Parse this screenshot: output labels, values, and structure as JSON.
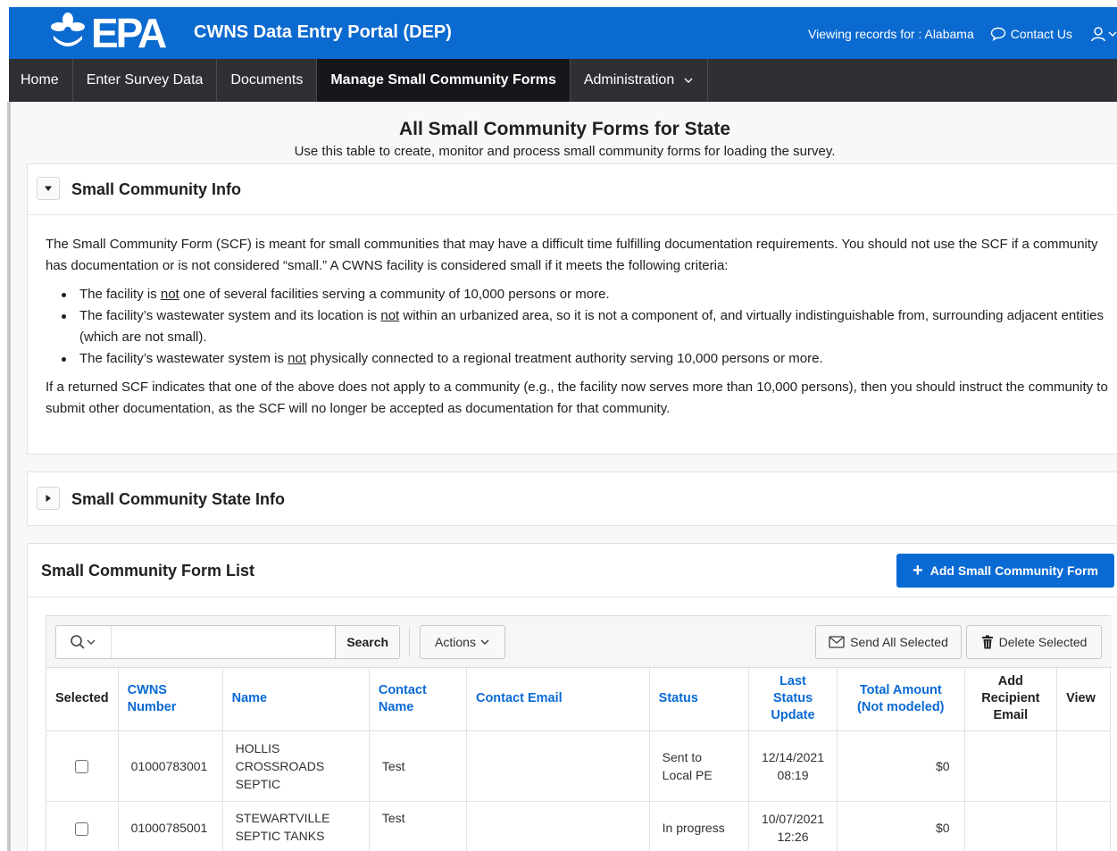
{
  "header": {
    "logo_text": "EPA",
    "app_title": "CWNS Data Entry Portal (DEP)",
    "viewing_records": "Viewing records for : Alabama",
    "contact_us": "Contact Us",
    "user_icon": "user-icon",
    "colors": {
      "brand": "#0b6ad0",
      "nav": "#2f3033",
      "nav_active": "#16171a",
      "primary_button": "#0a6ad4"
    }
  },
  "nav": {
    "items": [
      {
        "label": "Home"
      },
      {
        "label": "Enter Survey Data"
      },
      {
        "label": "Documents"
      },
      {
        "label": "Manage Small Community Forms"
      },
      {
        "label": "Administration"
      }
    ],
    "active": "Manage Small Community Forms"
  },
  "page": {
    "title": "All Small Community Forms for State",
    "subtitle": "Use this table to create, monitor and process small community forms for loading the survey."
  },
  "info_region": {
    "title": "Small Community Info",
    "expanded": true,
    "p1": "The Small Community Form (SCF) is meant for small communities that may have a difficult time fulfilling documentation requirements. You should not use the SCF if a community has documentation or is not considered “small.” A CWNS facility is considered small if it meets the following criteria:",
    "bullets": [
      {
        "before": "The facility is ",
        "under": "not",
        "after": " one of several facilities serving a community of 10,000 persons or more."
      },
      {
        "before": "The facility’s wastewater system and its location is ",
        "under": "not",
        "after": " within an urbanized area, so it is not a component of, and virtually indistinguishable from, surrounding adjacent entities (which are not small)."
      },
      {
        "before": "The facility’s wastewater system is ",
        "under": "not",
        "after": " physically connected to a regional treatment authority serving 10,000 persons or more."
      }
    ],
    "p2": "If a returned SCF indicates that one of the above does not apply to a community (e.g., the facility now serves more than 10,000 persons), then you should instruct the community to submit other documentation, as the SCF will no longer be accepted as documentation for that community."
  },
  "state_region": {
    "title": "Small Community State Info",
    "expanded": false
  },
  "list_region": {
    "title": "Small Community Form List",
    "add_button": "Add Small Community Form",
    "toolbar": {
      "search_value": "",
      "search_label": "Search",
      "actions_label": "Actions",
      "send_all_label": "Send All Selected",
      "delete_label": "Delete Selected"
    },
    "columns": {
      "selected": "Selected",
      "cwns_1": "CWNS",
      "cwns_2": "Number",
      "name": "Name",
      "contact_1": "Contact",
      "contact_2": "Name",
      "email": "Contact Email",
      "status": "Status",
      "last_1": "Last Status",
      "last_2": "Update",
      "total_1": "Total Amount",
      "total_2": "(Not modeled)",
      "add_1": "Add",
      "add_2": "Recipient",
      "add_3": "Email",
      "view": "View"
    },
    "rows": [
      {
        "cwns": "01000783001",
        "name_1": "HOLLIS",
        "name_2": "CROSSROADS",
        "name_3": "SEPTIC",
        "contact": "Test",
        "email": "",
        "status_1": "Sent to",
        "status_2": "Local PE",
        "date": "12/14/2021",
        "time": "08:19",
        "total": "$0"
      },
      {
        "cwns": "01000785001",
        "name_1": "STEWARTVILLE",
        "name_2": "SEPTIC TANKS",
        "contact": "Test",
        "email": "",
        "status_1": "In progress",
        "date": "10/07/2021",
        "time": "12:26",
        "total": "$0"
      }
    ]
  }
}
